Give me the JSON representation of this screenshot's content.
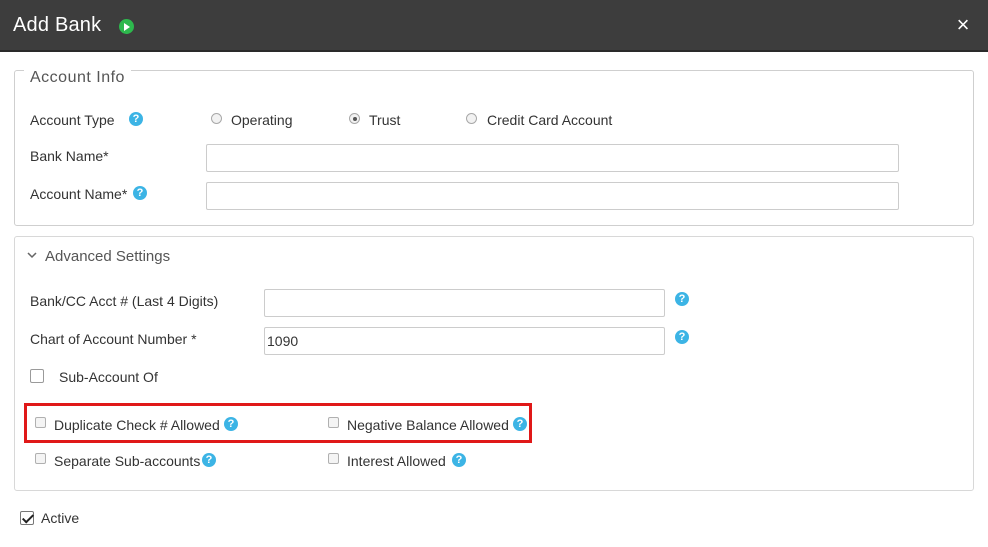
{
  "header": {
    "title": "Add Bank",
    "close_glyph": "×",
    "icons": [
      "play-circle-icon",
      "close-icon"
    ],
    "play_color": "#2db84d"
  },
  "account_info": {
    "legend": "Account Info",
    "account_type_label": "Account Type",
    "account_type_options": [
      {
        "label": "Operating",
        "selected": false
      },
      {
        "label": "Trust",
        "selected": true
      },
      {
        "label": "Credit Card Account",
        "selected": false
      }
    ],
    "bank_name_label": "Bank Name*",
    "bank_name_value": "",
    "account_name_label": "Account Name*",
    "account_name_value": ""
  },
  "advanced": {
    "title": "Advanced Settings",
    "acct_digits_label": "Bank/CC Acct # (Last 4 Digits)",
    "acct_digits_value": "",
    "chart_account_label": "Chart of Account Number *",
    "chart_account_value": "1090",
    "sub_account_label": "Sub-Account Of",
    "sub_account_checked": false,
    "options": [
      {
        "label": "Duplicate Check # Allowed",
        "checked": false
      },
      {
        "label": "Negative Balance Allowed",
        "checked": false
      },
      {
        "label": "Separate Sub-accounts",
        "checked": false
      },
      {
        "label": "Interest Allowed",
        "checked": false
      }
    ],
    "highlight_color": "#e01818"
  },
  "active": {
    "label": "Active",
    "checked": true
  },
  "colors": {
    "header_bg": "#3d3d3d",
    "help_icon": "#3cb4e5"
  },
  "help_glyph": "?"
}
